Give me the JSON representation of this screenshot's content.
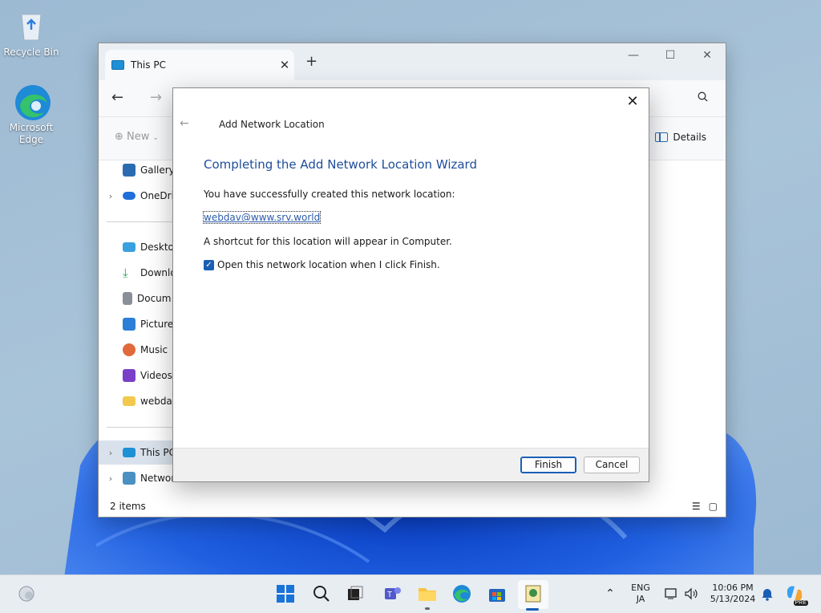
{
  "desktop": {
    "icons": [
      {
        "label": "Recycle Bin"
      },
      {
        "label": "Microsoft Edge"
      }
    ]
  },
  "explorer": {
    "tab_title": "This PC",
    "tab_close": "✕",
    "new_tab": "+",
    "window_controls": {
      "minimize": "—",
      "maximize": "☐",
      "close": "✕"
    },
    "nav": {
      "back": "←",
      "forward": "→",
      "search_icon": "🔍"
    },
    "cmd": {
      "new_label": "New",
      "details_label": "Details"
    },
    "sidebar": [
      {
        "label": "Gallery",
        "color": "#2b6cb0",
        "chevron": ""
      },
      {
        "label": "OneDriv",
        "color": "#1e6fd9",
        "chevron": "›"
      },
      {
        "label": "Desktop",
        "color": "#3aa0e0",
        "chevron": ""
      },
      {
        "label": "Downlo",
        "color": "#2e9b53",
        "chevron": ""
      },
      {
        "label": "Docum",
        "color": "#8a8f99",
        "chevron": ""
      },
      {
        "label": "Pictures",
        "color": "#2b7fd6",
        "chevron": ""
      },
      {
        "label": "Music",
        "color": "#e06a3a",
        "chevron": ""
      },
      {
        "label": "Videos",
        "color": "#7a3ec9",
        "chevron": ""
      },
      {
        "label": "webdav",
        "color": "#f2c94c",
        "chevron": ""
      },
      {
        "label": "This PC",
        "color": "#1e90d6",
        "chevron": "›"
      },
      {
        "label": "Networ",
        "color": "#4a90c2",
        "chevron": "›"
      }
    ],
    "status": "2 items"
  },
  "dialog": {
    "close": "✕",
    "back": "←",
    "title": "Add Network Location",
    "heading": "Completing the Add Network Location Wizard",
    "line1": "You have successfully created this network location:",
    "link": "webdav@www.srv.world",
    "line2": "A shortcut for this location will appear in Computer.",
    "checkbox_label": "Open this network location when I click Finish.",
    "checkbox_checked": true,
    "finish": "Finish",
    "cancel": "Cancel"
  },
  "taskbar": {
    "lang_top": "ENG",
    "lang_bottom": "JA",
    "time": "10:06 PM",
    "date": "5/13/2024",
    "copilot_badge": "PRE"
  },
  "colors": {
    "accent": "#1a5fb4",
    "heading": "#1e4d9b"
  }
}
